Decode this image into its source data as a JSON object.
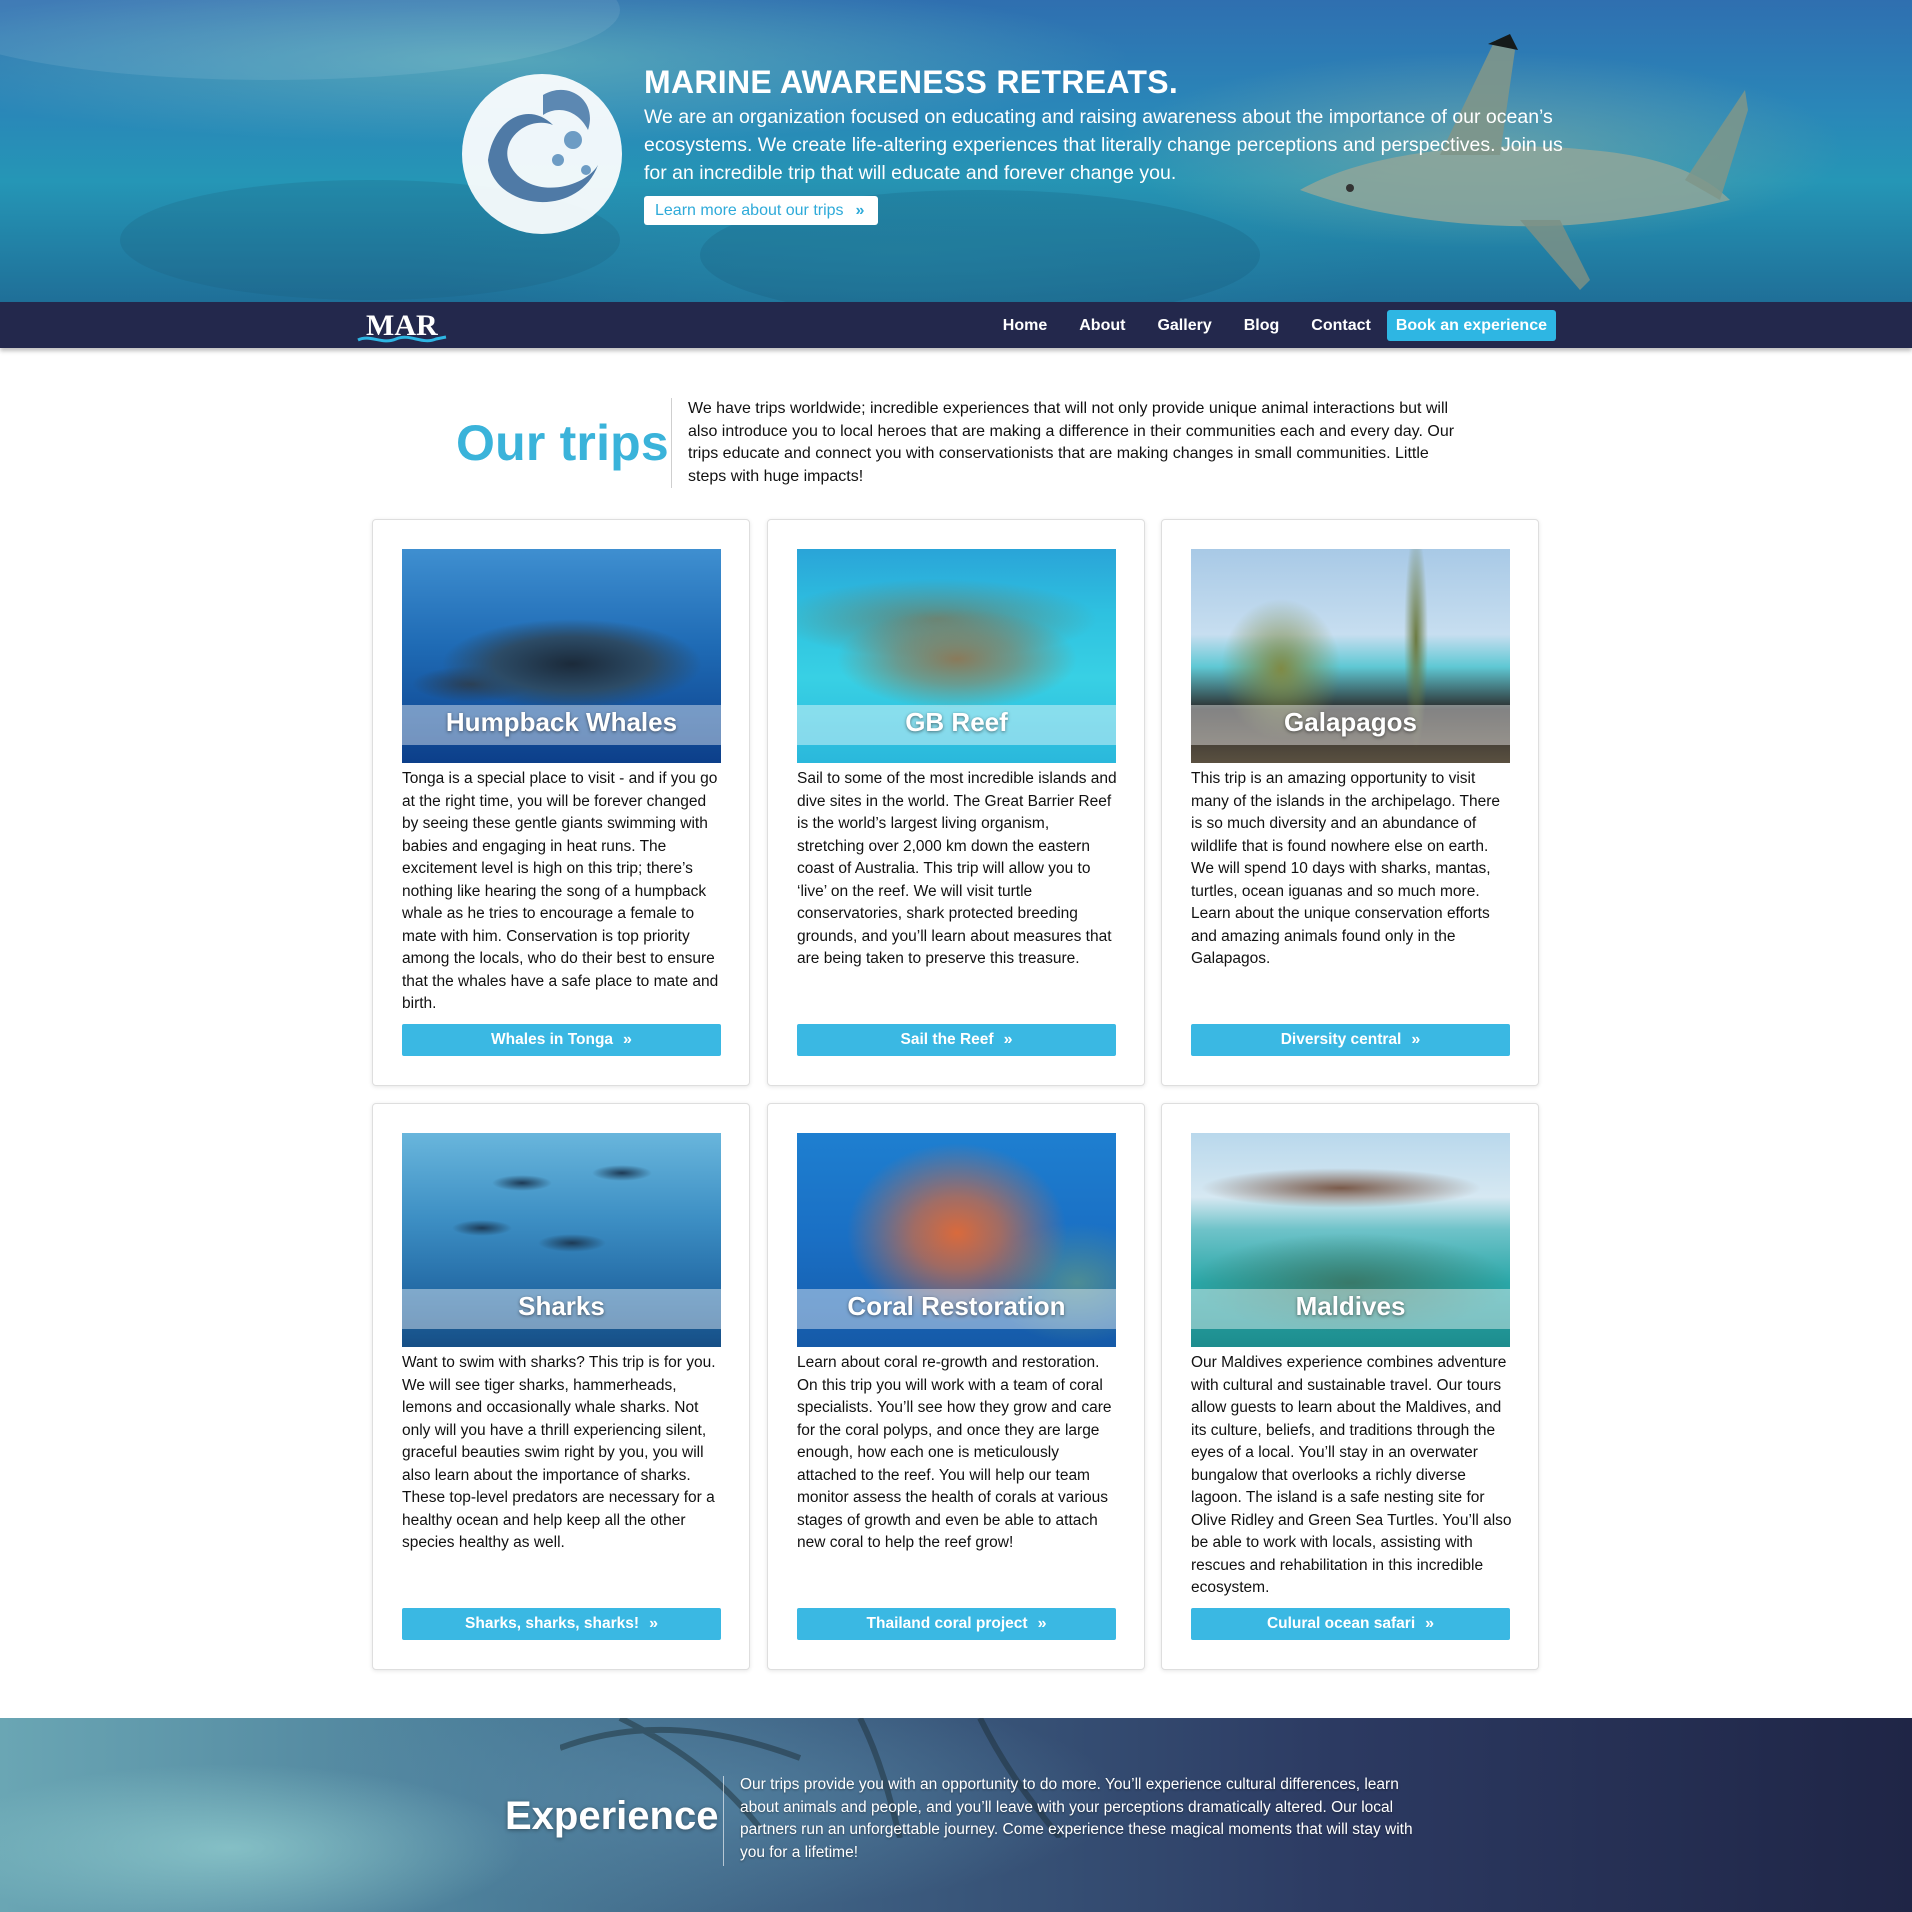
{
  "hero": {
    "title": "MARINE AWARENESS RETREATS.",
    "text": "We are an organization focused on educating and raising awareness about the importance of our ocean’s ecosystems. We create life-altering experiences that literally change perceptions and perspectives. Join us for an incredible trip that will educate and forever change you.",
    "button_label": "Learn more about our trips"
  },
  "nav": {
    "logo_text": "MAR",
    "items": [
      "Home",
      "About",
      "Gallery",
      "Blog",
      "Contact"
    ],
    "book_label": "Book an experience"
  },
  "intro": {
    "title": "Our trips",
    "text": "We have trips worldwide; incredible experiences that will not only provide unique animal interactions but will also introduce you to local heroes that are making a difference in their communities each and every day. Our trips educate and connect you with conservationists that are making changes in small communities. Little steps with huge impacts!"
  },
  "trips": [
    {
      "title": "Humpback Whales",
      "text": "Tonga is a special place to visit - and if you go at the right time, you will be forever changed by seeing these gentle giants swimming with babies and engaging in heat runs. The excitement level is high on this trip; there’s nothing like hearing the song of a humpback whale as he tries to encourage a female to mate with him. Conservation is top priority among the locals, who do their best to ensure that the whales have a safe place to mate and birth.",
      "button": "Whales in Tonga"
    },
    {
      "title": "GB Reef",
      "text": "Sail to some of the most incredible islands and dive sites in the world. The Great Barrier Reef is the world’s largest living organism, stretching over 2,000 km down the eastern coast of Australia. This trip will allow you to ‘live’ on the reef. We will visit turtle conservatories, shark protected breeding grounds, and you’ll learn about measures that are being taken to preserve this treasure.",
      "button": "Sail the Reef"
    },
    {
      "title": "Galapagos",
      "text": "This trip is an amazing opportunity to visit many of the islands in the archipelago. There is so much diversity and an abundance of wildlife that is found nowhere else on earth. We will spend 10 days with sharks, mantas, turtles, ocean iguanas and so much more. Learn about the unique conservation efforts and amazing animals found only in the Galapagos.",
      "button": "Diversity central"
    },
    {
      "title": "Sharks",
      "text": "Want to swim with sharks? This trip is for you. We will see tiger sharks, hammerheads, lemons and occasionally whale sharks. Not only will you have a thrill experiencing silent, graceful beauties swim right by you, you will also learn about the importance of sharks. These top-level predators are necessary for a healthy ocean and help keep all the other species healthy as well.",
      "button": "Sharks, sharks, sharks!"
    },
    {
      "title": "Coral Restoration",
      "text": "Learn about coral re-growth and restoration. On this trip you will work with a team of coral specialists. You’ll see how they grow and care for the coral polyps, and once they are large enough, how each one is meticulously attached to the reef. You will help our team monitor assess the health of corals at various stages of growth and even be able to attach new coral to help the reef grow!",
      "button": "Thailand coral project"
    },
    {
      "title": "Maldives",
      "text": "Our Maldives experience combines adventure with cultural and sustainable travel. Our tours allow guests to learn about the Maldives, and its culture, beliefs, and traditions through the eyes of a local. You’ll stay in an overwater bungalow that overlooks a richly diverse lagoon. The island is a safe nesting site for Olive Ridley and Green Sea Turtles. You’ll also be able to work with locals, assisting with rescues and rehabilitation in this incredible ecosystem.",
      "button": "Culural ocean safari"
    }
  ],
  "experience": {
    "title": "Experience",
    "text": "Our trips provide you with an opportunity to do more. You’ll experience cultural differences, learn about animals and people, and you’ll leave with your perceptions dramatically altered. Our local partners run an unforgettable journey. Come experience these magical moments that will stay with you for a lifetime!"
  },
  "colors": {
    "accent": "#3ab8e3",
    "nav_bg": "#23284c",
    "title_blue": "#3ab3da"
  },
  "icons": {
    "chevron": "double-chevron-right-icon",
    "hero_logo": "wave-splash-logo-icon"
  }
}
